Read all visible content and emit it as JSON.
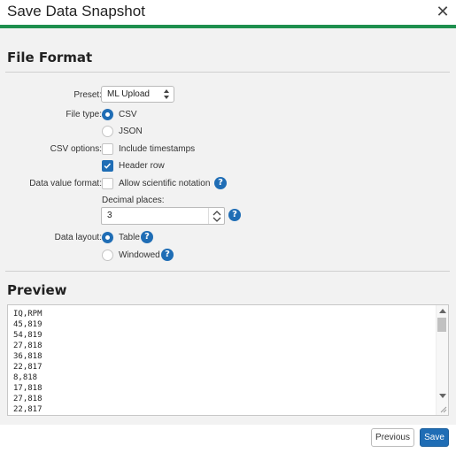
{
  "dialog": {
    "title": "Save Data Snapshot",
    "accent_color": "#1e8f4e",
    "close_icon": "close-icon"
  },
  "file_format": {
    "heading": "File Format",
    "preset": {
      "label": "Preset:",
      "value": "ML Upload"
    },
    "file_type": {
      "label": "File type:",
      "options": [
        {
          "label": "CSV",
          "selected": true
        },
        {
          "label": "JSON",
          "selected": false
        }
      ]
    },
    "csv_options": {
      "label": "CSV options:",
      "options": [
        {
          "label": "Include timestamps",
          "checked": false
        },
        {
          "label": "Header row",
          "checked": true
        }
      ]
    },
    "data_value_format": {
      "label": "Data value format:",
      "scientific_label": "Allow scientific notation",
      "scientific_checked": false,
      "decimal_places_label": "Decimal places:",
      "decimal_places_value": "3"
    },
    "data_layout": {
      "label": "Data layout:",
      "options": [
        {
          "label": "Table",
          "selected": true
        },
        {
          "label": "Windowed",
          "selected": false
        }
      ]
    }
  },
  "preview": {
    "heading": "Preview",
    "lines": [
      "IQ,RPM",
      "45,819",
      "54,819",
      "27,818",
      "36,818",
      "22,817",
      "8,818",
      "17,818",
      "27,818",
      "22,817"
    ]
  },
  "footer": {
    "previous_label": "Previous",
    "save_label": "Save",
    "primary_color": "#1f6db5"
  },
  "help_icon_glyph": "?"
}
